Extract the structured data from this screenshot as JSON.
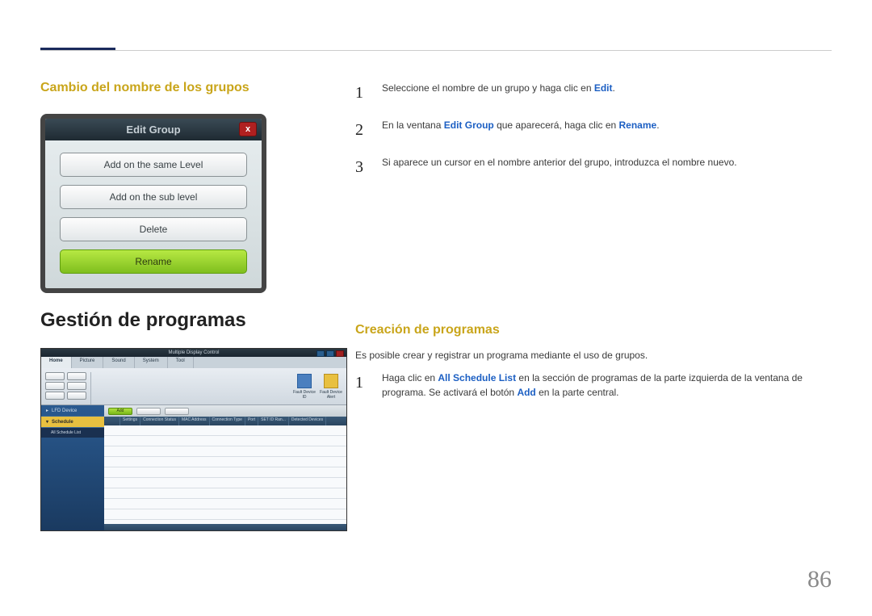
{
  "section1": {
    "title": "Cambio del nombre de los grupos",
    "dialog": {
      "title": "Edit Group",
      "close": "x",
      "btn1": "Add on the same Level",
      "btn2": "Add on the sub level",
      "btn3": "Delete",
      "btn4": "Rename"
    },
    "steps": [
      {
        "num": "1",
        "pre": "Seleccione el nombre de un grupo y haga clic en ",
        "b1": "Edit",
        "post": "."
      },
      {
        "num": "2",
        "pre": "En la ventana ",
        "b1": "Edit Group",
        "mid": " que aparecerá, haga clic en ",
        "b2": "Rename",
        "post": "."
      },
      {
        "num": "3",
        "pre": "Si aparece un cursor en el nombre anterior del grupo, introduzca el nombre nuevo."
      }
    ]
  },
  "section2": {
    "title": "Gestión de programas",
    "subtitle": "Creación de programas",
    "intro": "Es posible crear y registrar un programa mediante el uso de grupos.",
    "steps": [
      {
        "num": "1",
        "pre": "Haga clic en ",
        "b1": "All Schedule List",
        "mid": " en la sección de programas de la parte izquierda de la ventana de programa. Se activará el botón ",
        "b2": "Add",
        "post": " en la parte central."
      }
    ],
    "app": {
      "title": "Multiple Display Control",
      "tabs": [
        "Home",
        "Picture",
        "Sound",
        "System",
        "Tool"
      ],
      "bigicon1": "Fault Device\nID",
      "bigicon2": "Fault Device\nAlert",
      "sidebar": {
        "item1": "LFD Device",
        "item2": "Schedule",
        "sub": "All Schedule List"
      },
      "addBtn": "Add",
      "cols": [
        "Settings",
        "Connection Status",
        "MAC Address",
        "Connection Type",
        "Port",
        "SET ID Ran...",
        "Detected Devices"
      ]
    }
  },
  "page": "86"
}
